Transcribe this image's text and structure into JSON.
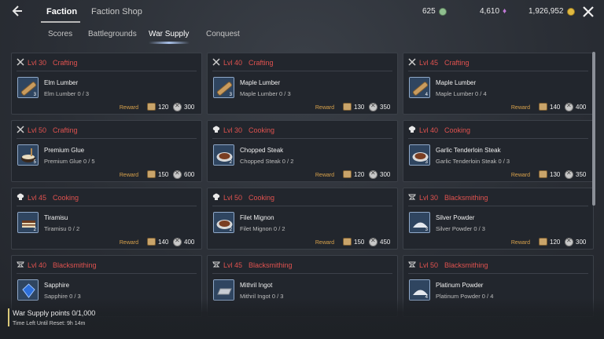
{
  "topbar": {
    "tabs": [
      {
        "label": "Faction",
        "active": true
      },
      {
        "label": "Faction Shop",
        "active": false
      }
    ],
    "currencies": [
      {
        "value": "625",
        "icon": "green-gem-icon",
        "color": "#8fbf8f"
      },
      {
        "value": "4,610",
        "icon": "purple-crystal-icon",
        "color": "#c07ad6"
      },
      {
        "value": "1,926,952",
        "icon": "gold-coin-icon",
        "color": "#e0b941"
      }
    ]
  },
  "subtabs": [
    {
      "label": "Scores",
      "active": false
    },
    {
      "label": "Battlegrounds",
      "active": false
    },
    {
      "label": "War Supply",
      "active": true
    },
    {
      "label": "Conquest",
      "active": false
    }
  ],
  "reward_label": "Reward",
  "cards": [
    {
      "level": "Lvl 30",
      "profession": "Crafting",
      "prof_icon": "crafting-icon",
      "item": "Elm Lumber",
      "progress": "Elm Lumber 0 / 3",
      "count": "3",
      "item_icon": "lumber-icon",
      "reward_box": "120",
      "reward_xp": "300"
    },
    {
      "level": "Lvl 40",
      "profession": "Crafting",
      "prof_icon": "crafting-icon",
      "item": "Maple Lumber",
      "progress": "Maple Lumber 0 / 3",
      "count": "3",
      "item_icon": "lumber-icon",
      "reward_box": "130",
      "reward_xp": "350"
    },
    {
      "level": "Lvl 45",
      "profession": "Crafting",
      "prof_icon": "crafting-icon",
      "item": "Maple Lumber",
      "progress": "Maple Lumber 0 / 4",
      "count": "4",
      "item_icon": "lumber-icon",
      "reward_box": "140",
      "reward_xp": "400"
    },
    {
      "level": "Lvl 50",
      "profession": "Crafting",
      "prof_icon": "crafting-icon",
      "item": "Premium Glue",
      "progress": "Premium Glue 0 / 5",
      "count": "5",
      "item_icon": "glue-pot-icon",
      "reward_box": "150",
      "reward_xp": "600"
    },
    {
      "level": "Lvl 30",
      "profession": "Cooking",
      "prof_icon": "chef-hat-icon",
      "item": "Chopped Steak",
      "progress": "Chopped Steak 0 / 2",
      "count": "2",
      "item_icon": "steak-plate-icon",
      "reward_box": "120",
      "reward_xp": "300"
    },
    {
      "level": "Lvl 40",
      "profession": "Cooking",
      "prof_icon": "chef-hat-icon",
      "item": "Garlic Tenderloin Steak",
      "progress": "Garlic Tenderloin Steak 0 / 3",
      "count": "3",
      "item_icon": "steak-plate-icon",
      "reward_box": "130",
      "reward_xp": "350"
    },
    {
      "level": "Lvl 45",
      "profession": "Cooking",
      "prof_icon": "chef-hat-icon",
      "item": "Tiramisu",
      "progress": "Tiramisu 0 / 2",
      "count": "2",
      "item_icon": "cake-icon",
      "reward_box": "140",
      "reward_xp": "400"
    },
    {
      "level": "Lvl 50",
      "profession": "Cooking",
      "prof_icon": "chef-hat-icon",
      "item": "Filet Mignon",
      "progress": "Filet Mignon 0 / 2",
      "count": "2",
      "item_icon": "steak-plate-icon",
      "reward_box": "150",
      "reward_xp": "450"
    },
    {
      "level": "Lvl 30",
      "profession": "Blacksmithing",
      "prof_icon": "anvil-icon",
      "item": "Silver Powder",
      "progress": "Silver Powder 0 / 3",
      "count": "3",
      "item_icon": "powder-icon",
      "reward_box": "120",
      "reward_xp": "300"
    },
    {
      "level": "Lvl 40",
      "profession": "Blacksmithing",
      "prof_icon": "anvil-icon",
      "item": "Sapphire",
      "progress": "Sapphire 0 / 3",
      "count": "",
      "item_icon": "gem-icon",
      "reward_box": "",
      "reward_xp": ""
    },
    {
      "level": "Lvl 45",
      "profession": "Blacksmithing",
      "prof_icon": "anvil-icon",
      "item": "Mithril Ingot",
      "progress": "Mithril Ingot 0 / 3",
      "count": "",
      "item_icon": "ingot-icon",
      "reward_box": "",
      "reward_xp": ""
    },
    {
      "level": "Lvl 50",
      "profession": "Blacksmithing",
      "prof_icon": "anvil-icon",
      "item": "Platinum Powder",
      "progress": "Platinum Powder 0 / 4",
      "count": "4",
      "item_icon": "powder-icon",
      "reward_box": "",
      "reward_xp": ""
    }
  ],
  "bottom": {
    "points": "War Supply points 0/1,000",
    "time_left": "Time Left Until Reset: 9h 14m"
  }
}
